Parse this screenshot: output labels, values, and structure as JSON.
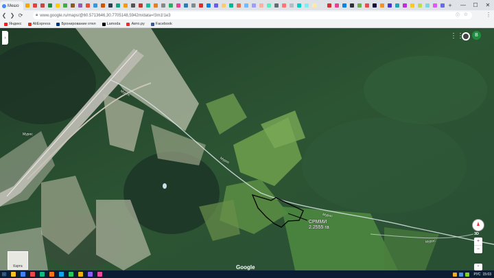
{
  "browser": {
    "first_tab_label": "Мешо",
    "tab_favicon_colors": [
      "#f2a900",
      "#e3423a",
      "#c44",
      "#1e8e3e",
      "#ffcc00",
      "#4a4",
      "#8b5a2b",
      "#9b59b6",
      "#e74c3c",
      "#3498db",
      "#d35400",
      "#2c3e50",
      "#16a085",
      "#f39c12",
      "#555",
      "#c0392b",
      "#1abc9c",
      "#e67e22",
      "#888",
      "#27ae60",
      "#e84393",
      "#2980b9",
      "#7f8c8d",
      "#d63031",
      "#0984e3",
      "#6c5ce7",
      "#fdcb6e",
      "#00b894",
      "#e17055",
      "#74b9ff",
      "#a29bfe",
      "#fab1a0",
      "#55efc4",
      "#636e72",
      "#ff7675",
      "#b2bec3",
      "#00cec9",
      "#81ecec",
      "#ffeaa7",
      "#dfe6e9",
      "#d63031",
      "#e84393",
      "#0984e3",
      "#2d3436",
      "#6ab04c",
      "#eb4d4b",
      "#130f40",
      "#f0932b",
      "#4834d4",
      "#22a6b3",
      "#be2edd",
      "#f9ca24",
      "#badc58",
      "#7ed6df",
      "#e056fd",
      "#686de0"
    ],
    "new_tab_icon": "plus-icon",
    "url": "www.google.ru/maps/@60.5713646,30.7705148,5942m/data=!3m1!1e3",
    "menu_icon": "kebab-menu-icon"
  },
  "bookmarks": [
    {
      "label": "Яндекс",
      "color": "#e22"
    },
    {
      "label": "AliExpress",
      "color": "#e43225"
    },
    {
      "label": "Бронирование отел",
      "color": "#003580"
    },
    {
      "label": "Lamoda",
      "color": "#000"
    },
    {
      "label": "Авто.ру",
      "color": "#d33"
    },
    {
      "label": "Facebook",
      "color": "#3b5998"
    }
  ],
  "map": {
    "road_labels": [
      {
        "text": "Мурос"
      },
      {
        "text": "Мурос"
      },
      {
        "text": "Мурос"
      },
      {
        "text": "Мурос"
      },
      {
        "text": "Мурос"
      }
    ],
    "annotation_lines": [
      "СРММИ",
      "2.2555 га"
    ],
    "google_logo": "Google",
    "layers_label": "Карта",
    "tilt_label": "3D",
    "zoom_in": "+",
    "zoom_out": "−",
    "avatar_letter": "В"
  },
  "taskbar": {
    "app_colors": [
      "#fbbf24",
      "#3b82f6",
      "#ef4444",
      "#10b981",
      "#f97316",
      "#0ea5e9",
      "#22c55e",
      "#eab308",
      "#8b5cf6",
      "#ec4899"
    ],
    "tray": {
      "lang": "РУС",
      "time": "15:03"
    }
  }
}
